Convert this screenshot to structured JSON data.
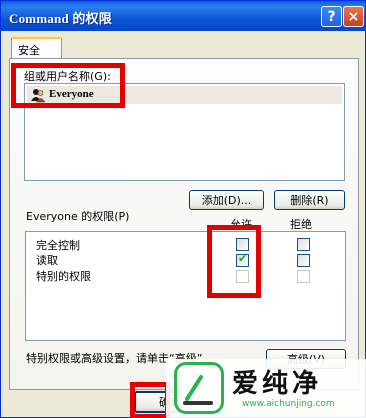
{
  "window": {
    "title": "Command 的权限",
    "help_label": "?",
    "close_label": "×"
  },
  "tabs": [
    {
      "label": "安全",
      "active": true
    }
  ],
  "groups": {
    "label": "组或用户名称(G):",
    "items": [
      {
        "name": "Everyone",
        "icon": "users-icon",
        "selected": true
      }
    ]
  },
  "buttons": {
    "add": "添加(D)...",
    "remove": "删除(R)",
    "advanced": "高级(V)",
    "ok": "确定"
  },
  "permissions": {
    "label": "Everyone 的权限(P)",
    "allow_header": "允许",
    "deny_header": "拒绝",
    "rows": [
      {
        "name": "完全控制",
        "allow": false,
        "deny": false,
        "enabled": true
      },
      {
        "name": "读取",
        "allow": true,
        "deny": false,
        "enabled": true
      },
      {
        "name": "特别的权限",
        "allow": false,
        "deny": false,
        "enabled": false
      }
    ]
  },
  "footer_text": "特别权限或高级设置，请单击“高级”。",
  "watermark": {
    "brand": "爱纯净",
    "url": "www.aichunjing.com",
    "accent": "#2bb24c"
  },
  "colors": {
    "titlebar": "#0b56d8",
    "highlight_box": "#e30000",
    "dialog_bg": "#ece9d8"
  }
}
